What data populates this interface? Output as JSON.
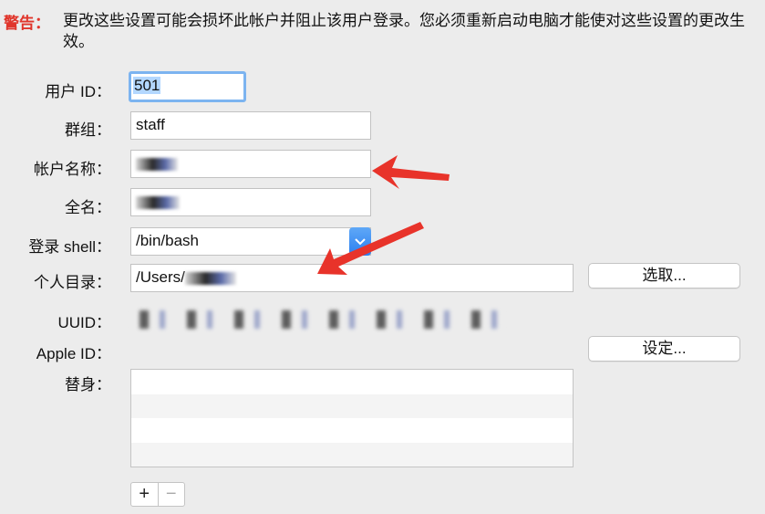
{
  "warning": {
    "label": "警告：",
    "text": "更改这些设置可能会损坏此帐户并阻止该用户登录。您必须重新启动电脑才能使对这些设置的更改生效。"
  },
  "fields": {
    "user_id": {
      "label": "用户 ID：",
      "value": "501"
    },
    "group": {
      "label": "群组：",
      "value": "staff"
    },
    "account_name": {
      "label": "帐户名称：",
      "value": ""
    },
    "full_name": {
      "label": "全名：",
      "value": ""
    },
    "login_shell": {
      "label": "登录 shell：",
      "value": "/bin/bash"
    },
    "home_directory": {
      "label": "个人目录：",
      "value": "/Users/"
    },
    "uuid": {
      "label": "UUID："
    },
    "apple_id": {
      "label": "Apple ID："
    },
    "aliases": {
      "label": "替身："
    }
  },
  "buttons": {
    "choose": "选取...",
    "set": "设定...",
    "add": "+",
    "remove": "−"
  },
  "icons": {
    "popup": "chevron-down-icon",
    "arrows": "annotation-arrow-icon"
  },
  "colors": {
    "warning": "#e0362c",
    "arrow": "#e8332a",
    "focus": "#7cb4f0"
  }
}
